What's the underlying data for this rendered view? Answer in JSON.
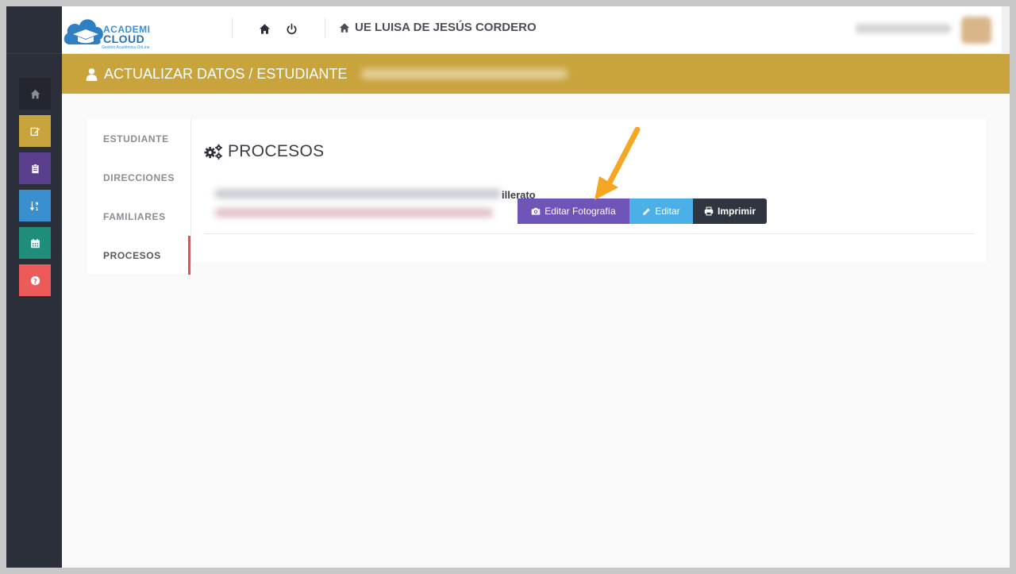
{
  "header": {
    "logo_line1": "ACADEMI",
    "logo_line2": "CLOUD",
    "logo_tagline": "Gestión Académica OnLine",
    "school_name": "UE LUISA DE JESÚS CORDERO"
  },
  "banner": {
    "title": "ACTUALIZAR DATOS / ESTUDIANTE"
  },
  "sidebar": {
    "items": [
      {
        "icon": "home-icon",
        "color": "#2b2f3a"
      },
      {
        "icon": "edit-icon",
        "color": "#c9a43d"
      },
      {
        "icon": "clipboard-icon",
        "color": "#5a3f8c"
      },
      {
        "icon": "sort-numeric-icon",
        "color": "#3a90cf"
      },
      {
        "icon": "calendar-icon",
        "color": "#1e8e7a"
      },
      {
        "icon": "question-icon",
        "color": "#ec5a5a"
      }
    ]
  },
  "tabs": [
    {
      "label": "ESTUDIANTE"
    },
    {
      "label": "DIRECCIONES"
    },
    {
      "label": "FAMILIARES"
    },
    {
      "label": "PROCESOS",
      "active": true
    }
  ],
  "panel": {
    "title": "PROCESOS",
    "course_text": "illerato",
    "buttons": {
      "photo": "Editar Fotografía",
      "edit": "Editar",
      "print": "Imprimir"
    }
  },
  "colors": {
    "banner": "#c9a43d",
    "photo_button": "#6f55b8",
    "edit_button": "#4cb0e8",
    "print_button": "#2f3640",
    "active_tab_marker": "#e84c4c",
    "arrow": "#f5a623"
  }
}
